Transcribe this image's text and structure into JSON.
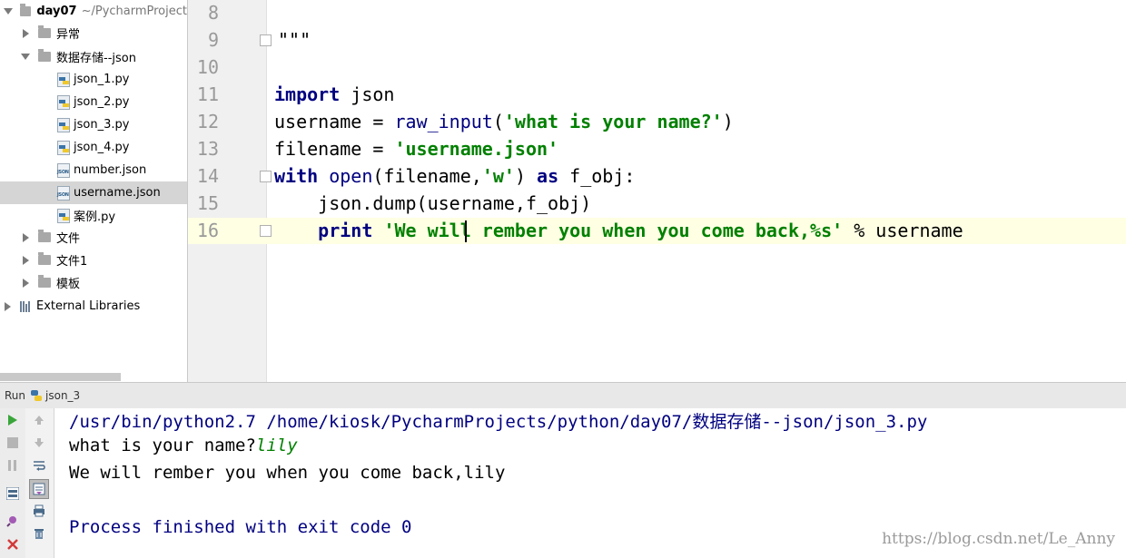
{
  "project_tree": {
    "root": {
      "name": "day07",
      "path": "~/PycharmProject"
    },
    "items": [
      {
        "label": "异常",
        "type": "folder",
        "expanded": false
      },
      {
        "label": "数据存储--json",
        "type": "folder",
        "expanded": true
      },
      {
        "label": "json_1.py",
        "type": "py"
      },
      {
        "label": "json_2.py",
        "type": "py"
      },
      {
        "label": "json_3.py",
        "type": "py"
      },
      {
        "label": "json_4.py",
        "type": "py"
      },
      {
        "label": "number.json",
        "type": "json"
      },
      {
        "label": "username.json",
        "type": "json",
        "selected": true
      },
      {
        "label": "案例.py",
        "type": "py"
      },
      {
        "label": "文件",
        "type": "folder",
        "expanded": false
      },
      {
        "label": "文件1",
        "type": "folder",
        "expanded": false
      },
      {
        "label": "模板",
        "type": "folder",
        "expanded": false
      }
    ],
    "external": "External Libraries",
    "json_badge": "JSON"
  },
  "editor": {
    "line_numbers": [
      "8",
      "9",
      "10",
      "11",
      "12",
      "13",
      "14",
      "15",
      "16"
    ],
    "tokens": {
      "l9": "\"\"\"",
      "import": "import",
      "json": " json",
      "username_assign": "username = ",
      "raw_input": "raw_input",
      "paren_open": "(",
      "prompt": "'what is your name?'",
      "paren_close": ")",
      "filename_assign": "filename = ",
      "filename_str": "'username.json'",
      "with": "with",
      "open": " open",
      "open_args_a": "(filename,",
      "mode": "'w'",
      "open_args_b": ") ",
      "as": "as",
      "fobj": " f_obj:",
      "dump": "    json.dump(username,f_obj)",
      "indent": "    ",
      "print": "print",
      "space": " ",
      "message": "'We will rember you when you come back,%s'",
      "format": " % username"
    }
  },
  "run": {
    "tab_label": "Run",
    "config": "json_3",
    "console": {
      "command": "/usr/bin/python2.7 /home/kiosk/PycharmProjects/python/day07/数据存储--json/json_3.py",
      "prompt": "what is your name?",
      "input": "lily",
      "output": "We will rember you when you come back,lily",
      "exit": "Process finished with exit code 0"
    }
  },
  "watermark": "https://blog.csdn.net/Le_Anny",
  "colors": {
    "keyword": "#000080",
    "string": "#008000",
    "console_blue": "#000080",
    "input_green": "#008000",
    "current_line": "#ffffe4",
    "selected_row": "#d5d5d5"
  }
}
